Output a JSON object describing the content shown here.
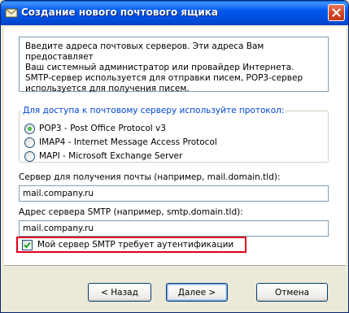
{
  "window": {
    "title": "Создание нового почтового ящика"
  },
  "info": {
    "lines": [
      "Введите адреса почтовых серверов. Эти адреса Вам предоставляет",
      "Ваш системный администратор или провайдер Интернета.",
      "SMTP-сервер используется для отправки писем, POP3-сервер",
      "используется для получения писем."
    ]
  },
  "protocol": {
    "legend": "Для доступа к почтовому серверу используйте протокол:",
    "options": [
      {
        "label": "POP3  -  Post Office Protocol v3",
        "checked": true
      },
      {
        "label": "IMAP4 - Internet Message Access Protocol",
        "checked": false
      },
      {
        "label": "MAPI - Microsoft Exchange Server",
        "checked": false
      }
    ]
  },
  "incoming": {
    "label": "Сервер для получения почты  (например, mail.domain.tld):",
    "value": "mail.company.ru"
  },
  "smtp": {
    "label": "Адрес сервера SMTP (например, smtp.domain.tld):",
    "value": "mail.company.ru"
  },
  "auth": {
    "label": "Мой сервер SMTP требует аутентификации",
    "checked": true
  },
  "buttons": {
    "back": "< Назад",
    "next": "Далее >",
    "cancel": "Отмена"
  },
  "colors": {
    "titlebar": "#0058ee",
    "highlight_border": "#e0001b",
    "legend_text": "#0046d5"
  },
  "icons": {
    "app": "mail-envelope-icon",
    "close": "close-icon"
  }
}
